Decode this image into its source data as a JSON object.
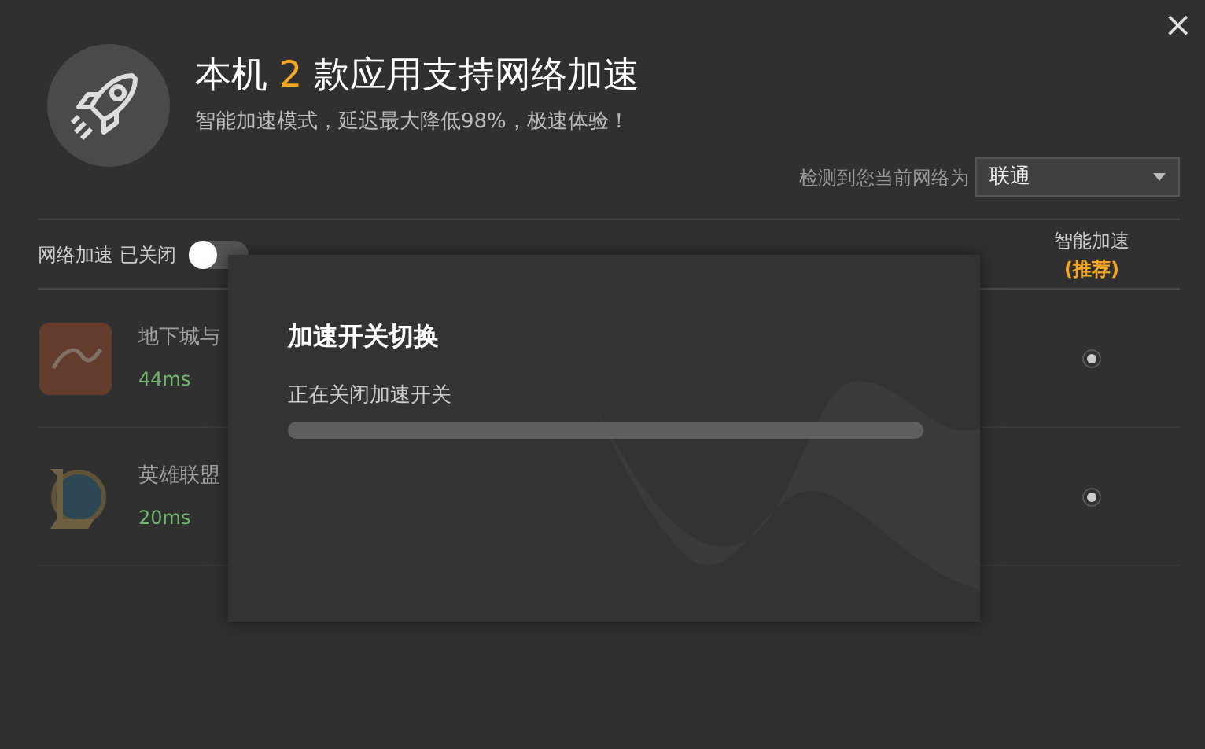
{
  "title": {
    "before": "本机",
    "count": "2",
    "after": "款应用支持网络加速"
  },
  "subtitle": "智能加速模式，延迟最大降低98%，极速体验！",
  "network": {
    "label": "检测到您当前网络为",
    "value": "联通"
  },
  "close": "×",
  "switch": {
    "label": "网络加速 已关闭",
    "on": false
  },
  "columns": [
    {
      "label": "智能加速",
      "note": "(推荐)"
    }
  ],
  "apps": [
    {
      "name": "地下城与",
      "latency": "44ms",
      "kind": "dnf",
      "disabled": true,
      "smart_selected": true
    },
    {
      "name": "英雄联盟",
      "latency": "20ms",
      "kind": "lol",
      "disabled": true,
      "smart_selected": true
    }
  ],
  "dialog": {
    "title": "加速开关切换",
    "message": "正在关闭加速开关",
    "level": 0
  }
}
